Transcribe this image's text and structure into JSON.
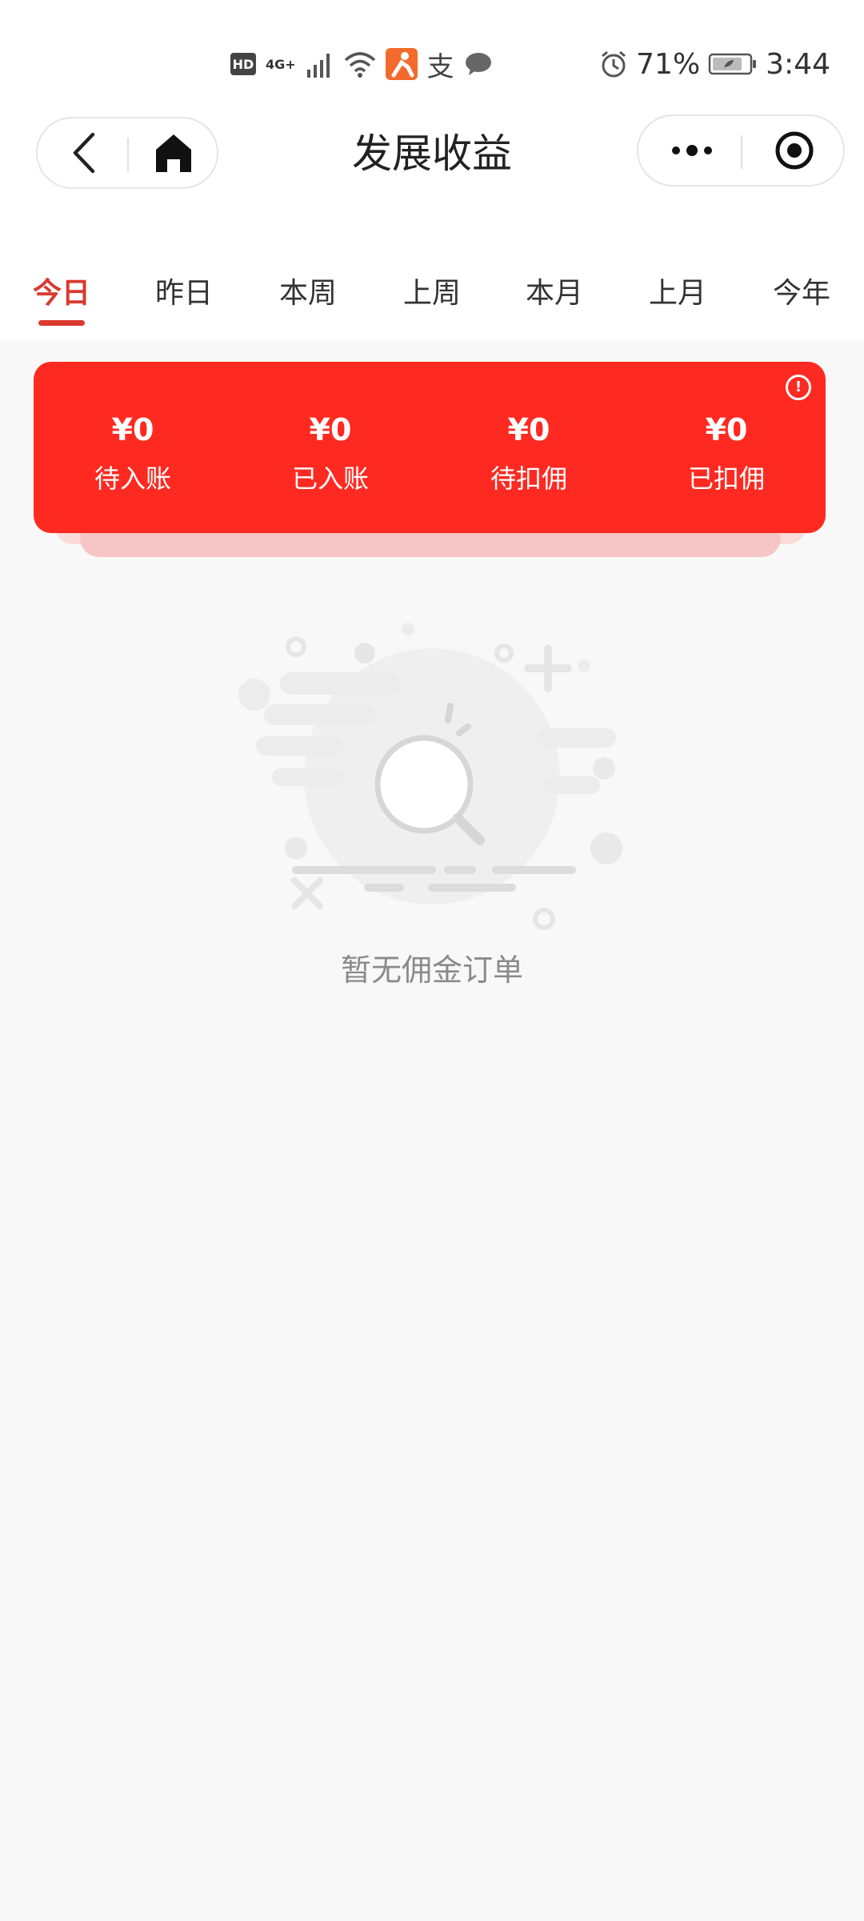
{
  "status_bar": {
    "hd": "HD",
    "network": "4G+",
    "alipay_glyph": "支",
    "battery_percent": "71%",
    "time": "3:44",
    "icons": [
      "hd-icon",
      "signal-icon",
      "wifi-icon",
      "app-icon",
      "alipay-icon",
      "chat-icon",
      "alarm-icon",
      "battery-icon"
    ]
  },
  "nav": {
    "title": "发展收益",
    "icons": [
      "back-icon",
      "home-icon",
      "more-icon",
      "target-icon"
    ]
  },
  "tabs": {
    "active_index": 0,
    "items": [
      {
        "label": "今日"
      },
      {
        "label": "昨日"
      },
      {
        "label": "本周"
      },
      {
        "label": "上周"
      },
      {
        "label": "本月"
      },
      {
        "label": "上月"
      },
      {
        "label": "今年"
      }
    ]
  },
  "summary": {
    "info_glyph": "!",
    "accent_color": "#fe2a21",
    "stats": [
      {
        "amount": "¥0",
        "label": "待入账"
      },
      {
        "amount": "¥0",
        "label": "已入账"
      },
      {
        "amount": "¥0",
        "label": "待扣佣"
      },
      {
        "amount": "¥0",
        "label": "已扣佣"
      }
    ]
  },
  "empty_state": {
    "message": "暂无佣金订单",
    "icon": "empty-search-illustration"
  }
}
